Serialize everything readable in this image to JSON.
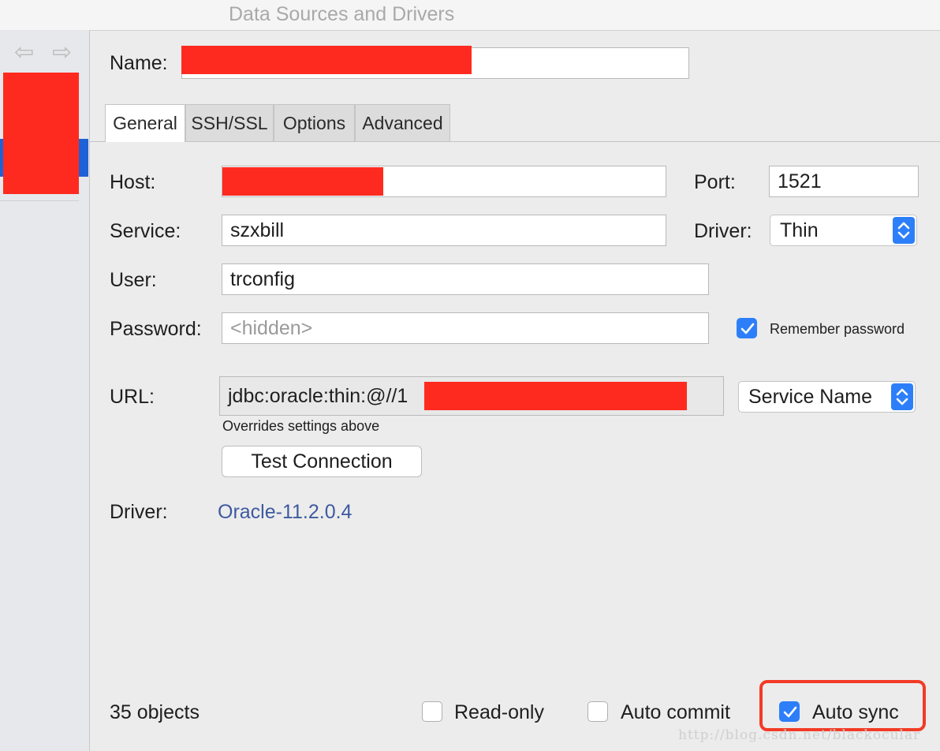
{
  "window": {
    "title": "Data Sources and Drivers"
  },
  "sidebar": {
    "back_icon": "arrow-left-icon",
    "forward_icon": "arrow-right-icon"
  },
  "form": {
    "name_label": "Name:",
    "tabs": [
      "General",
      "SSH/SSL",
      "Options",
      "Advanced"
    ],
    "host_label": "Host:",
    "port_label": "Port:",
    "port_value": "1521",
    "service_label": "Service:",
    "service_value": "szxbill",
    "driver_label": "Driver:",
    "driver_value": "Thin",
    "user_label": "User:",
    "user_value": "trconfig",
    "password_label": "Password:",
    "password_placeholder": "<hidden>",
    "remember_password_label": "Remember password",
    "remember_password_checked": true,
    "url_label": "URL:",
    "url_value": "jdbc:oracle:thin:@//1",
    "url_type_value": "Service Name",
    "overrides_note": "Overrides settings above",
    "test_connection_label": "Test Connection",
    "driver_info_label": "Driver:",
    "driver_link": "Oracle-11.2.0.4"
  },
  "footer": {
    "objects_count": "35 objects",
    "read_only_label": "Read-only",
    "read_only_checked": false,
    "auto_commit_label": "Auto commit",
    "auto_commit_checked": false,
    "auto_sync_label": "Auto sync",
    "auto_sync_checked": true
  },
  "watermark": "http://blog.csdn.net/blackocular",
  "colors": {
    "accent": "#2d7ff9",
    "redaction": "#ff2a1f",
    "highlight": "#f23b26",
    "link": "#3d5aa0"
  }
}
